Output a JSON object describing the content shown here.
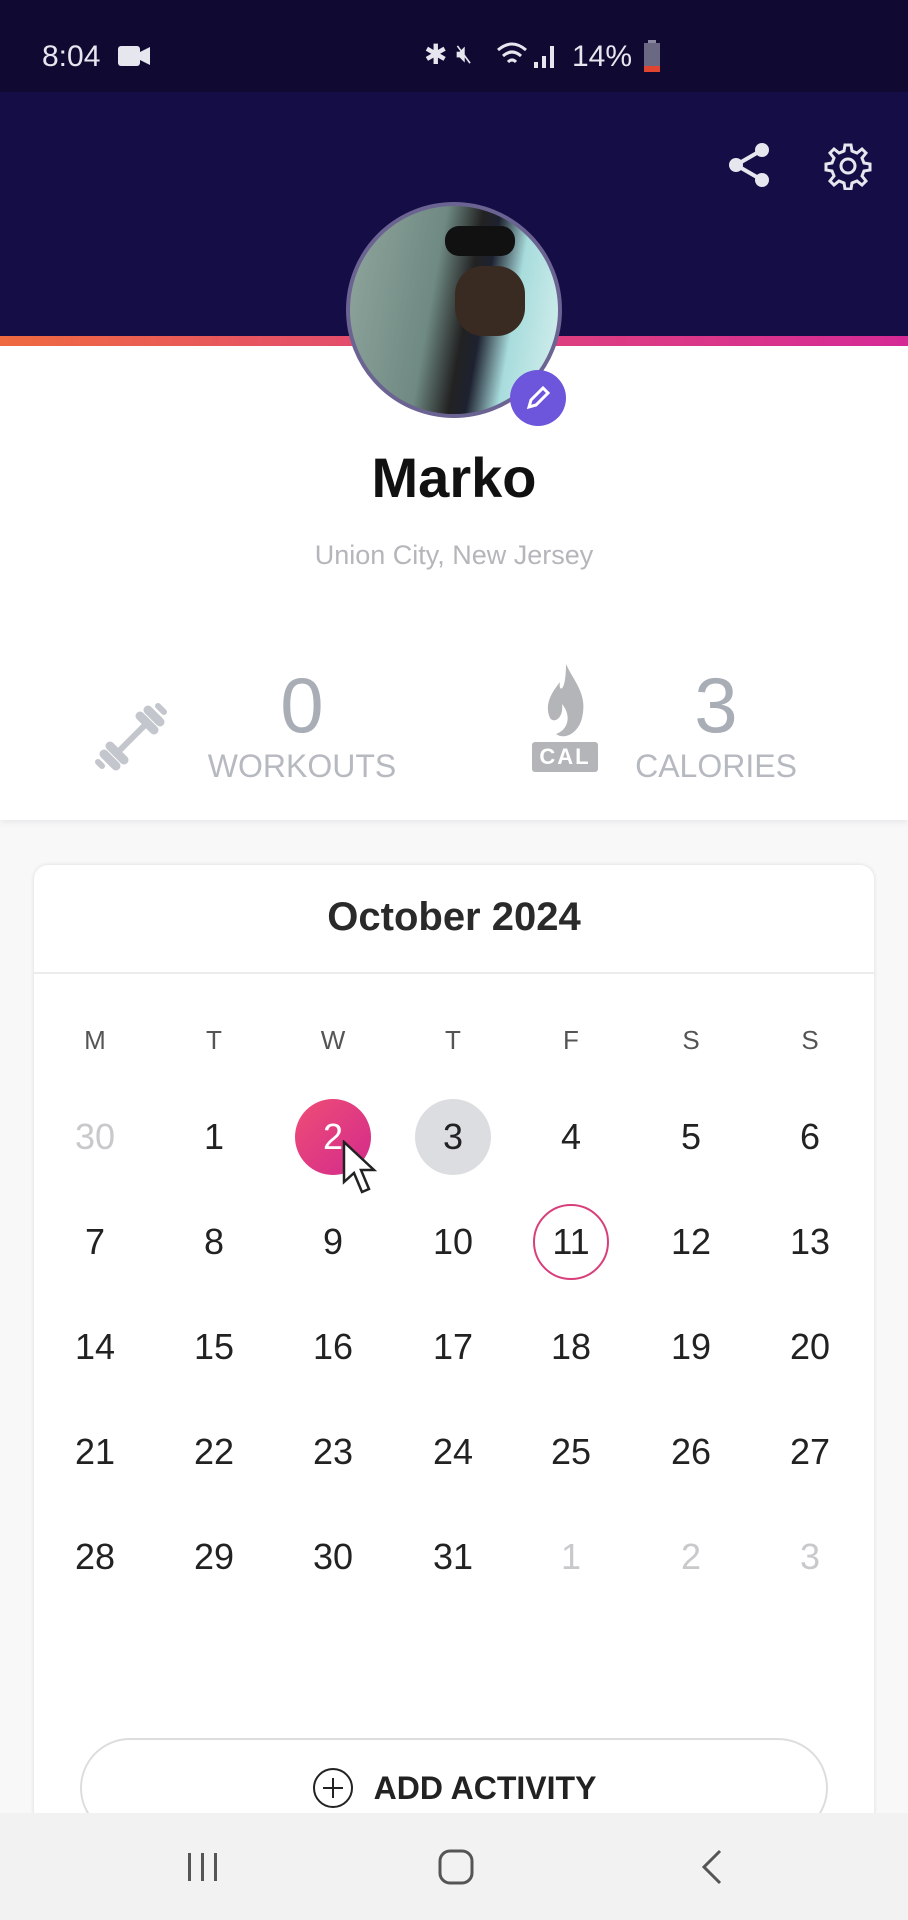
{
  "status_bar": {
    "time": "8:04",
    "battery": "14%",
    "icons": [
      "video-icon",
      "bluetooth-icon",
      "mute-icon",
      "wifi-icon",
      "signal-icon",
      "battery-icon"
    ]
  },
  "header": {
    "icons": [
      "share-icon",
      "gear-icon"
    ]
  },
  "profile": {
    "name": "Marko",
    "location": "Union City, New Jersey"
  },
  "stats": [
    {
      "value": "0",
      "label": "WORKOUTS",
      "icon": "dumbbell-icon"
    },
    {
      "value": "3",
      "label": "CALORIES",
      "icon": "calories-flame-icon",
      "icon_text": "CAL"
    }
  ],
  "calendar": {
    "month": "October 2024",
    "weekdays": [
      "M",
      "T",
      "W",
      "T",
      "F",
      "S",
      "S"
    ],
    "weeks": [
      [
        {
          "d": "30",
          "o": 1
        },
        {
          "d": "1"
        },
        {
          "d": "2",
          "s": "selected"
        },
        {
          "d": "3",
          "s": "today"
        },
        {
          "d": "4"
        },
        {
          "d": "5"
        },
        {
          "d": "6"
        }
      ],
      [
        {
          "d": "7"
        },
        {
          "d": "8"
        },
        {
          "d": "9"
        },
        {
          "d": "10"
        },
        {
          "d": "11",
          "s": "marked"
        },
        {
          "d": "12"
        },
        {
          "d": "13"
        }
      ],
      [
        {
          "d": "14"
        },
        {
          "d": "15"
        },
        {
          "d": "16"
        },
        {
          "d": "17"
        },
        {
          "d": "18"
        },
        {
          "d": "19"
        },
        {
          "d": "20"
        }
      ],
      [
        {
          "d": "21"
        },
        {
          "d": "22"
        },
        {
          "d": "23"
        },
        {
          "d": "24"
        },
        {
          "d": "25"
        },
        {
          "d": "26"
        },
        {
          "d": "27"
        }
      ],
      [
        {
          "d": "28"
        },
        {
          "d": "29"
        },
        {
          "d": "30"
        },
        {
          "d": "31"
        },
        {
          "d": "1",
          "o": 1
        },
        {
          "d": "2",
          "o": 1
        },
        {
          "d": "3",
          "o": 1
        }
      ]
    ]
  },
  "add_activity": {
    "label": "ADD ACTIVITY"
  },
  "colors": {
    "header": "#150d45",
    "accent": "#d83f7a",
    "edit": "#6d55dc"
  }
}
